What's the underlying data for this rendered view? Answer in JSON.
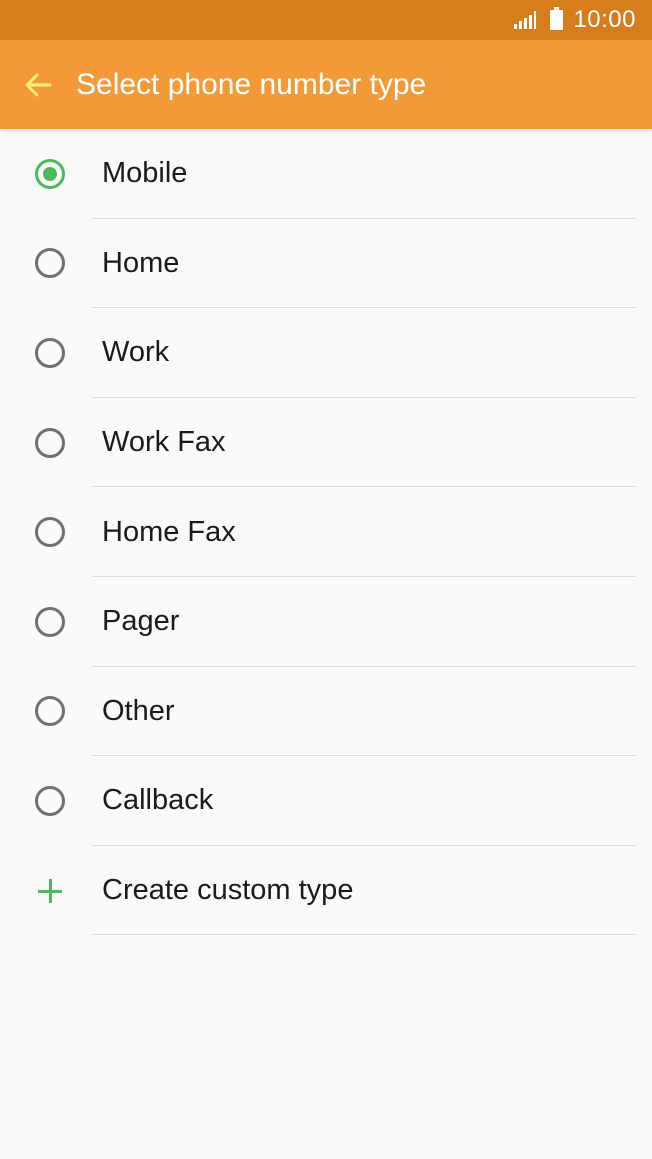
{
  "status_bar": {
    "time": "10:00",
    "signal_icon": "signal-icon",
    "battery_icon": "battery-icon"
  },
  "app_bar": {
    "back_icon": "arrow-back-icon",
    "title": "Select phone number type",
    "background_color": "#f29a38",
    "back_icon_color": "#fff176"
  },
  "options": [
    {
      "label": "Mobile",
      "selected": true
    },
    {
      "label": "Home",
      "selected": false
    },
    {
      "label": "Work",
      "selected": false
    },
    {
      "label": "Work Fax",
      "selected": false
    },
    {
      "label": "Home Fax",
      "selected": false
    },
    {
      "label": "Pager",
      "selected": false
    },
    {
      "label": "Other",
      "selected": false
    },
    {
      "label": "Callback",
      "selected": false
    }
  ],
  "create_custom": {
    "label": "Create custom type",
    "icon": "plus-icon",
    "accent_color": "#4cba5c"
  }
}
